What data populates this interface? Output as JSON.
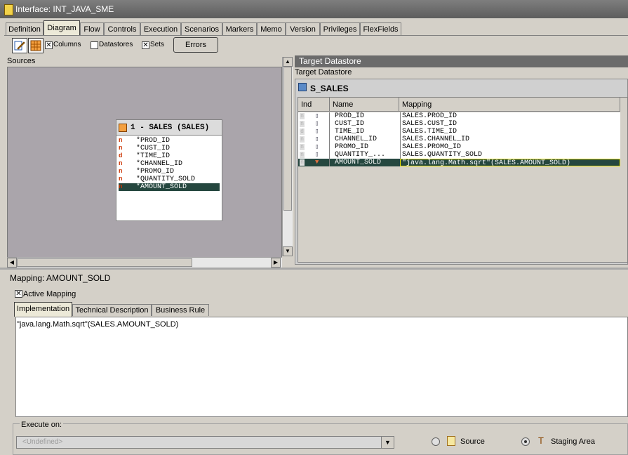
{
  "window": {
    "title": "Interface: INT_JAVA_SME"
  },
  "tabs": [
    {
      "label": "Definition",
      "active": false
    },
    {
      "label": "Diagram",
      "active": true
    },
    {
      "label": "Flow",
      "active": false
    },
    {
      "label": "Controls",
      "active": false
    },
    {
      "label": "Execution",
      "active": false
    },
    {
      "label": "Scenarios",
      "active": false
    },
    {
      "label": "Markers",
      "active": false
    },
    {
      "label": "Memo",
      "active": false
    },
    {
      "label": "Version",
      "active": false
    },
    {
      "label": "Privileges",
      "active": false
    },
    {
      "label": "FlexFields",
      "active": false
    }
  ],
  "toolbar": {
    "columns_label": "Columns",
    "columns_checked": true,
    "datastores_label": "Datastores",
    "datastores_checked": false,
    "sets_label": "Sets",
    "sets_checked": true,
    "errors_label": "Errors"
  },
  "sources": {
    "label": "Sources",
    "datastore": {
      "title": "1 - SALES (SALES)",
      "columns": [
        {
          "flag": "n",
          "name": "*PROD_ID"
        },
        {
          "flag": "n",
          "name": "*CUST_ID"
        },
        {
          "flag": "d",
          "name": "*TIME_ID"
        },
        {
          "flag": "n",
          "name": "*CHANNEL_ID"
        },
        {
          "flag": "n",
          "name": "*PROMO_ID"
        },
        {
          "flag": "n",
          "name": "*QUANTITY_SOLD"
        },
        {
          "flag": "n",
          "name": "*AMOUNT_SOLD",
          "selected": true
        }
      ]
    }
  },
  "target": {
    "panel_title": "Target Datastore",
    "subtitle": "Target Datastore",
    "datastore_name": "S_SALES",
    "headers": {
      "ind": "Ind",
      "name": "Name",
      "mapping": "Mapping"
    },
    "rows": [
      {
        "ind": "n",
        "name": "PROD_ID",
        "mapping": "SALES.PROD_ID"
      },
      {
        "ind": "n",
        "name": "CUST_ID",
        "mapping": "SALES.CUST_ID"
      },
      {
        "ind": "d",
        "name": "TIME_ID",
        "mapping": "SALES.TIME_ID"
      },
      {
        "ind": "n",
        "name": "CHANNEL_ID",
        "mapping": "SALES.CHANNEL_ID"
      },
      {
        "ind": "n",
        "name": "PROMO_ID",
        "mapping": "SALES.PROMO_ID"
      },
      {
        "ind": "n",
        "name": "QUANTITY_...",
        "mapping": "SALES.QUANTITY_SOLD"
      },
      {
        "ind": "n",
        "name": "AMOUNT_SOLD",
        "mapping": "\"java.lang.Math.sqrt\"(SALES.AMOUNT_SOLD)",
        "selected": true
      }
    ]
  },
  "mapping_panel": {
    "title": "Mapping: AMOUNT_SOLD",
    "active_mapping_label": "Active Mapping",
    "active_mapping_checked": true,
    "tabs": [
      {
        "label": "Implementation",
        "active": true
      },
      {
        "label": "Technical Description",
        "active": false
      },
      {
        "label": "Business Rule",
        "active": false
      }
    ],
    "expression": "\"java.lang.Math.sqrt\"(SALES.AMOUNT_SOLD)"
  },
  "execute_on": {
    "label": "Execute on:",
    "select_value": "<Undefined>",
    "source_label": "Source",
    "staging_label": "Staging Area",
    "selected": "staging"
  }
}
